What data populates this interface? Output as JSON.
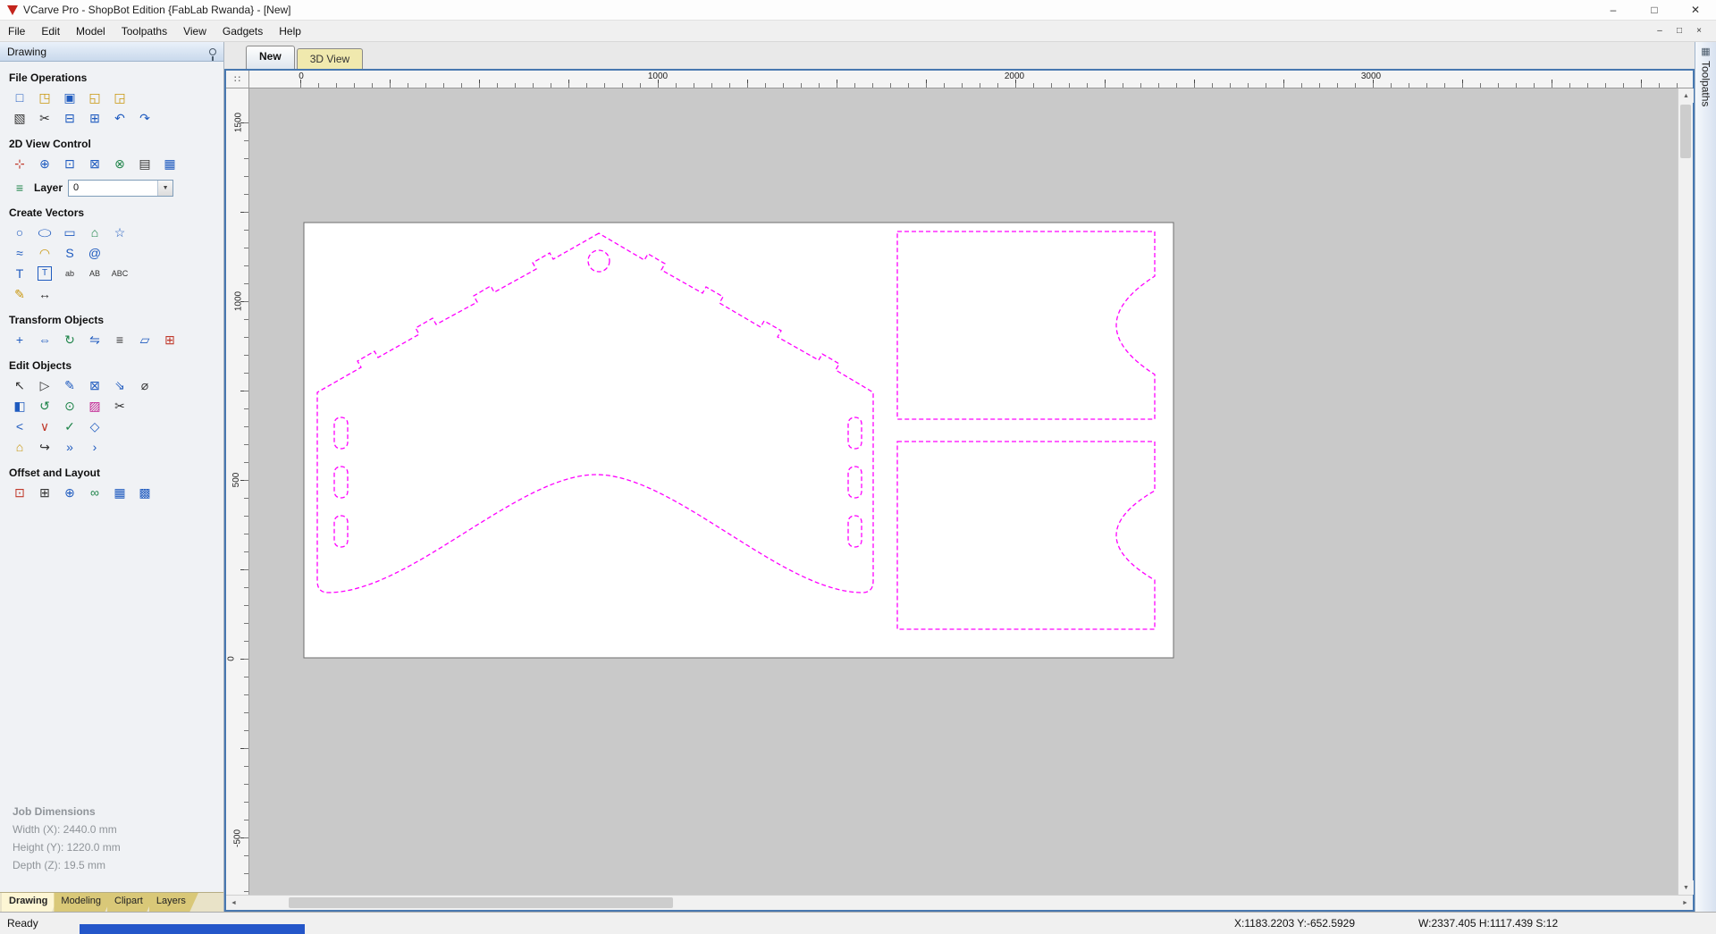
{
  "window": {
    "title": "VCarve Pro - ShopBot Edition {FabLab Rwanda} - [New]"
  },
  "titlebar_controls": {
    "minimize": "–",
    "maximize": "□",
    "close": "✕"
  },
  "menu": {
    "items": [
      "File",
      "Edit",
      "Model",
      "Toolpaths",
      "View",
      "Gadgets",
      "Help"
    ]
  },
  "doc_controls": {
    "minimize": "–",
    "restore": "□",
    "close": "×"
  },
  "sidebar": {
    "panel_title": "Drawing",
    "sections": {
      "file_operations": "File Operations",
      "view_control": "2D View Control",
      "create_vectors": "Create Vectors",
      "transform_objects": "Transform Objects",
      "edit_objects": "Edit Objects",
      "offset_layout": "Offset and Layout"
    },
    "layer": {
      "label": "Layer",
      "value": "0"
    },
    "job_dimensions": {
      "title": "Job Dimensions",
      "width": "Width  (X): 2440.0 mm",
      "height": "Height (Y): 1220.0 mm",
      "depth": "Depth  (Z): 19.5 mm"
    },
    "tabs": [
      "Drawing",
      "Modeling",
      "Clipart",
      "Layers"
    ]
  },
  "view": {
    "tabs": [
      "New",
      "3D View"
    ],
    "toolpaths_tab": "Toolpaths",
    "ruler_top": [
      "0",
      "1000",
      "2000",
      "3000"
    ],
    "ruler_left": [
      "1500",
      "1000",
      "500",
      "0",
      "-500"
    ]
  },
  "statusbar": {
    "ready": "Ready",
    "xy": "X:1183.2203 Y:-652.5929",
    "whs": "W:2337.405   H:1117.439  S:12"
  },
  "colors": {
    "vector_magenta": "#ff00ff",
    "frame_blue": "#4878b0"
  },
  "icons": {
    "new_file": "□",
    "open_file": "◳",
    "save": "▣",
    "import_vectors": "◱",
    "export_vectors": "◲",
    "selection": "▧",
    "cut": "✂",
    "copy": "⊟",
    "paste": "⊞",
    "undo": "↶",
    "redo": "↷",
    "pan": "⊹",
    "zoom_interactive": "⊕",
    "zoom_box": "⊡",
    "zoom_drawing": "⊠",
    "zoom_selected": "⊗",
    "guides": "▤",
    "grid": "▦",
    "layer_stack": "≡",
    "dropdown_arrow": "▼",
    "circle": "○",
    "ellipse": "◯",
    "rectangle": "▭",
    "polygon": "⌂",
    "star": "☆",
    "draw_line": "≈",
    "draw_arc": "◠",
    "draw_curve": "S",
    "draw_spiral": "@",
    "text": "T",
    "text_box": "T",
    "text_on_curve": "ab",
    "text_spacing": "AB",
    "convert_text": "ABC",
    "trim_pencil": "✎",
    "dimension": "↔",
    "move": "+",
    "scale": "⇔",
    "rotate": "↻",
    "mirror": "⇋",
    "align": "≡",
    "distort": "▱",
    "center": "⊞",
    "select": "↖",
    "node_edit": "▷",
    "edit_pencil": "✎",
    "snap_grid": "⊠",
    "stretch": "⇘",
    "measure": "⌀",
    "group": "◧",
    "ungroup": "↺",
    "fillet": "⊙",
    "erase": "▨",
    "scissors": "✂",
    "join_open": "<",
    "join_close": "∨",
    "validate": "✓",
    "convert_curves": "◇",
    "weld": "⌂",
    "smooth_join": "↪",
    "extend": "»",
    "trim_to": "›",
    "offset": "⊡",
    "array_copy": "⊞",
    "circular_copy": "⊕",
    "copy_along": "∞",
    "nesting": "▦",
    "texture": "▩",
    "scroll_up": "▲",
    "scroll_down": "▼",
    "scroll_left": "◄",
    "scroll_right": "►",
    "corner_dots": "∷"
  }
}
